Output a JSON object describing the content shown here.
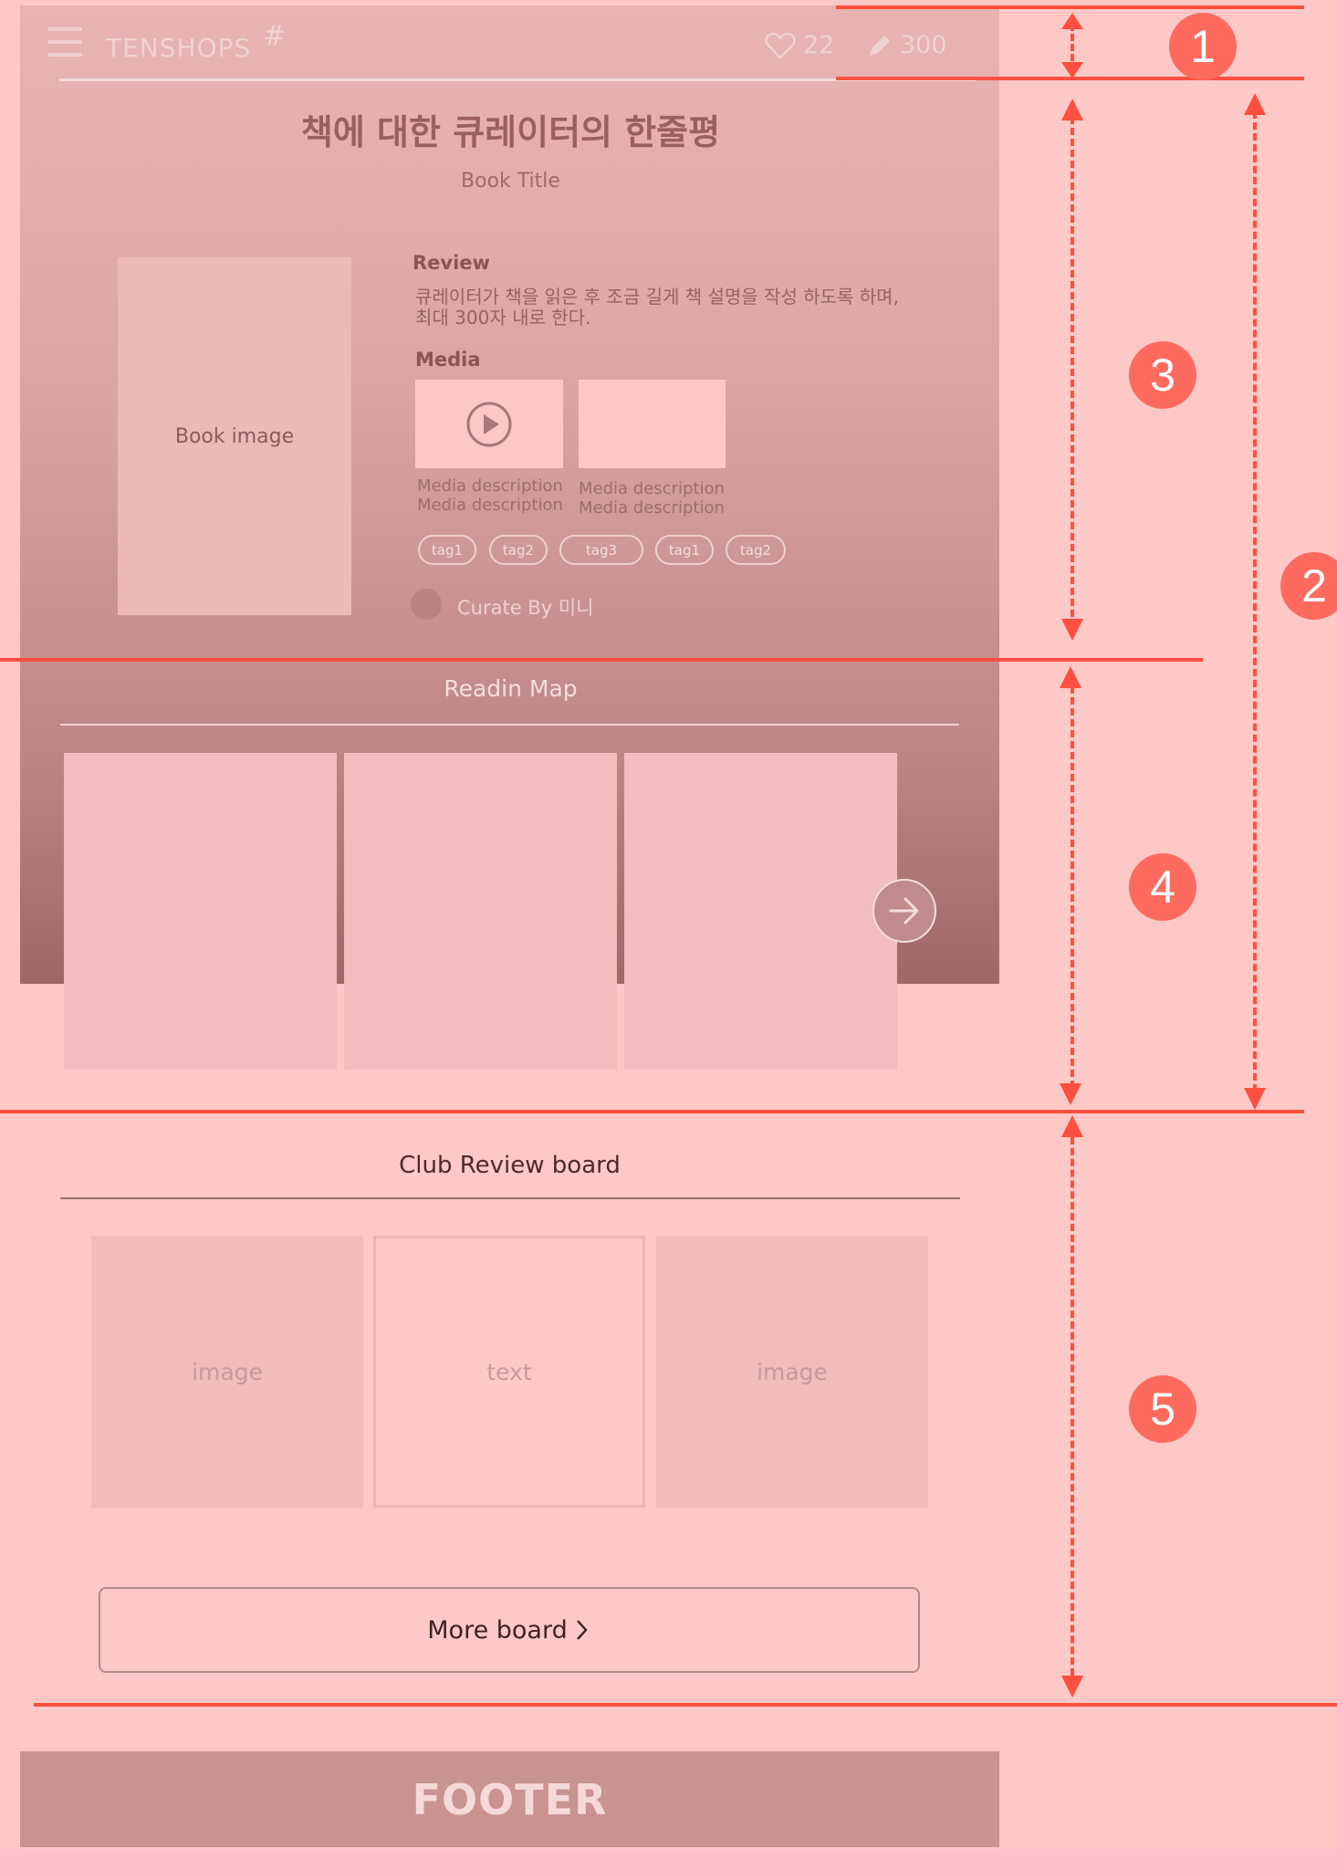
{
  "header": {
    "brand": "TENSHOPS",
    "hash": "#",
    "likes": "22",
    "edits": "300"
  },
  "hero": {
    "title": "책에 대한 큐레이터의 한줄평",
    "subtitle": "Book Title",
    "book_image_label": "Book image",
    "review_label": "Review",
    "review_line1": "큐레이터가 책을 읽은 후 조금 길게 책 설명을 작성 하도록 하며,",
    "review_line2": "최대 300자 내로 한다.",
    "media_label": "Media",
    "media": [
      {
        "desc1": "Media description",
        "desc2": "Media description"
      },
      {
        "desc1": "Media description",
        "desc2": "Media description"
      }
    ],
    "tags": [
      "tag1",
      "tag2",
      "tag3",
      "tag1",
      "tag2"
    ],
    "curator": "Curate By 미니"
  },
  "reading_map": {
    "title": "Readin Map"
  },
  "club": {
    "title": "Club Review board",
    "cards": [
      "image",
      "text",
      "image"
    ],
    "more_label": "More board"
  },
  "footer": {
    "label": "FOOTER"
  },
  "annotations": {
    "badges": [
      "1",
      "2",
      "3",
      "4",
      "5"
    ],
    "line_color": "#ff4f3f",
    "badge_color": "#fe6b5e"
  }
}
